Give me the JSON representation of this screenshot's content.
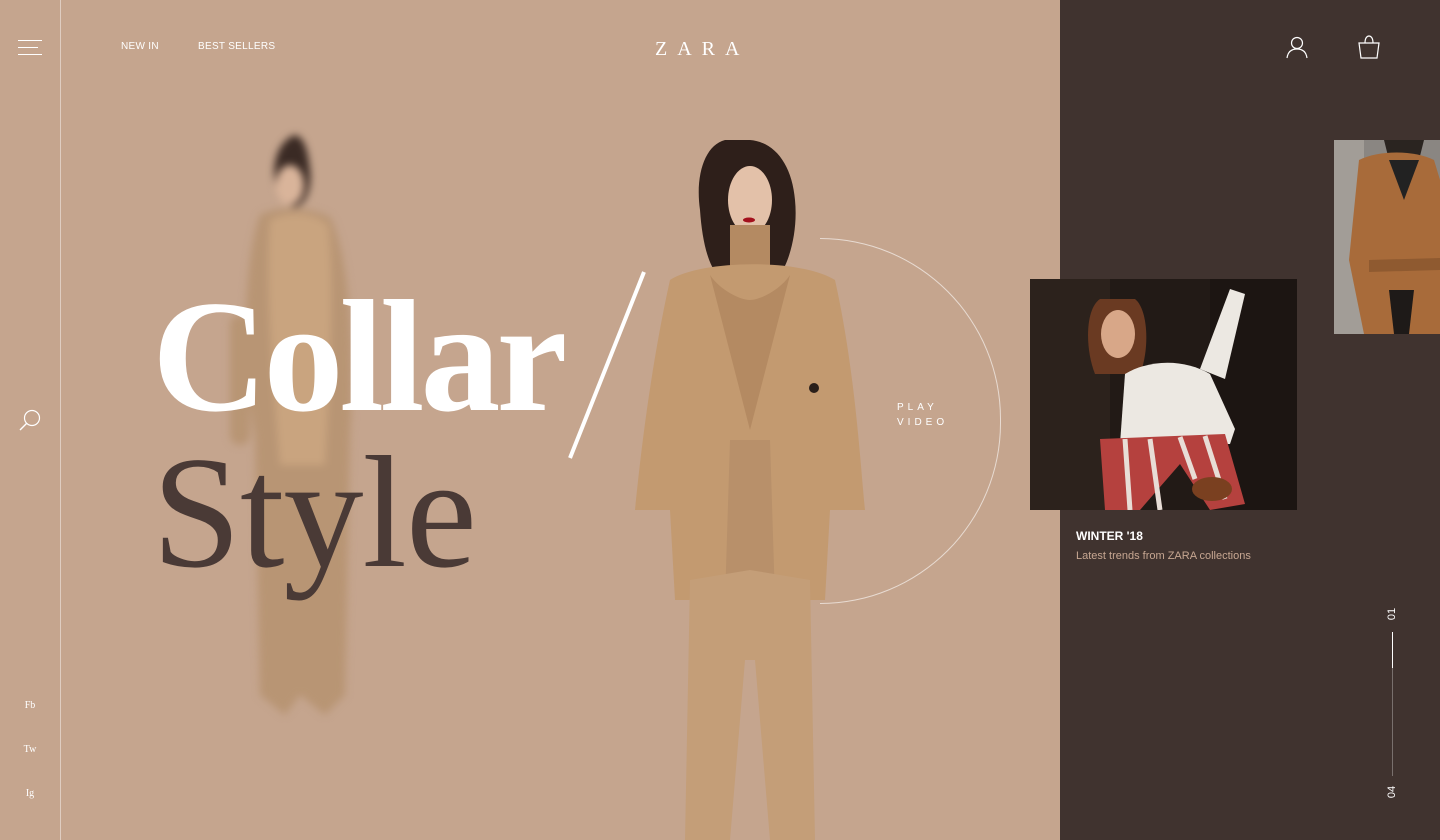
{
  "nav": {
    "new_in": "NEW IN",
    "best_sellers": "BEST SELLERS"
  },
  "brand": {
    "logo": "ZARA"
  },
  "hero": {
    "line1": "Collar",
    "line2": "Style",
    "play_line1": "PLAY",
    "play_line2": "VIDEO"
  },
  "social": {
    "facebook": "Fb",
    "twitter": "Tw",
    "instagram": "Ig"
  },
  "card": {
    "title": "WINTER '18",
    "subtitle": "Latest trends from ZARA collections"
  },
  "slider": {
    "current": "01",
    "total": "04",
    "progress": 0.25
  },
  "icons": {
    "menu": "hamburger-menu-icon",
    "search": "search-icon",
    "account": "user-icon",
    "bag": "shopping-bag-icon"
  },
  "colors": {
    "background": "#c5a58e",
    "panel": "#40332f",
    "accent_dark": "#4a3a36",
    "text_light": "#ffffff",
    "subtitle": "#c7a792"
  }
}
